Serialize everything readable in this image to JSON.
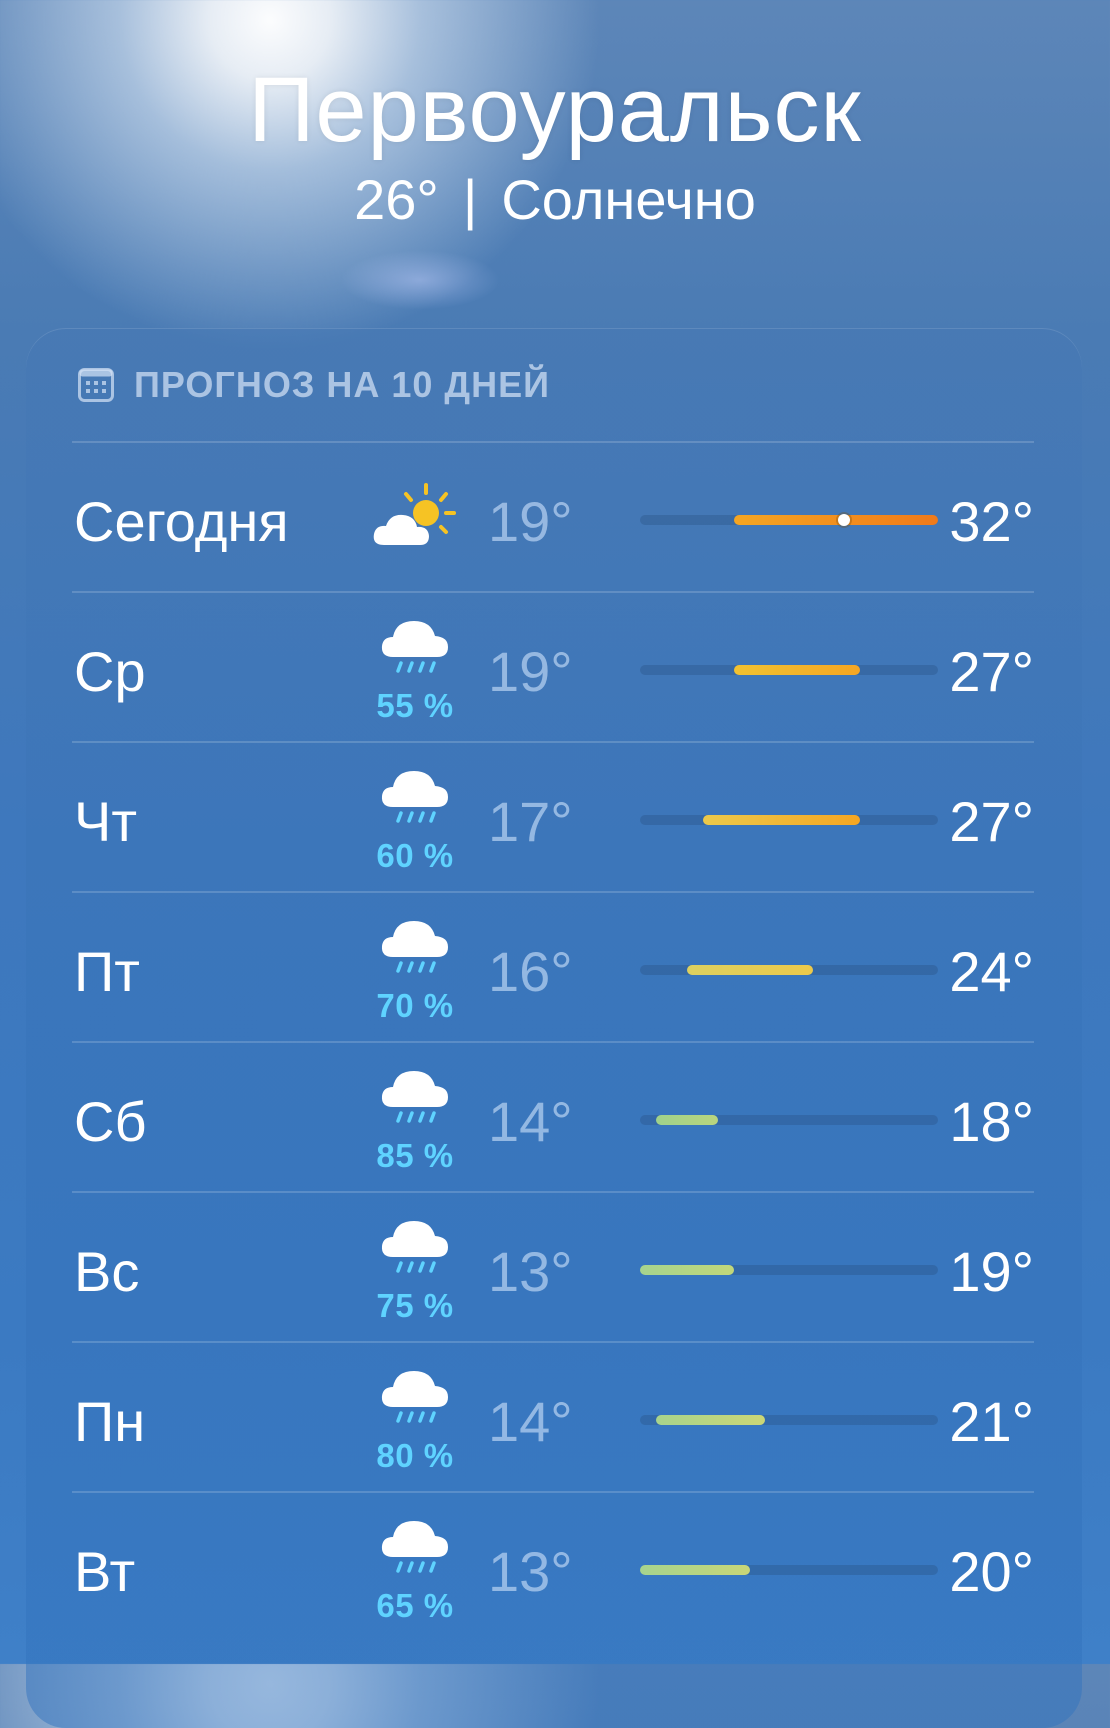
{
  "location": {
    "city": "Первоуральск",
    "current_temp": "26°",
    "separator": "|",
    "condition": "Солнечно"
  },
  "forecast": {
    "title": "ПРОГНОЗ НА 10 ДНЕЙ",
    "header_icon": "calendar-icon",
    "range_min": 13,
    "range_max": 32,
    "current_temp_value": 26,
    "days": [
      {
        "day": "Сегодня",
        "icon": "partly-sunny-icon",
        "precip": "",
        "low": "19°",
        "high": "32°",
        "low_value": 19,
        "high_value": 32,
        "current": true,
        "colors": [
          "#f5a623",
          "#f07a1a"
        ]
      },
      {
        "day": "Ср",
        "icon": "rain-icon",
        "precip": "55 %",
        "low": "19°",
        "high": "27°",
        "low_value": 19,
        "high_value": 27,
        "current": false,
        "colors": [
          "#f1c232",
          "#f5a623"
        ]
      },
      {
        "day": "Чт",
        "icon": "rain-icon",
        "precip": "60 %",
        "low": "17°",
        "high": "27°",
        "low_value": 17,
        "high_value": 27,
        "current": false,
        "colors": [
          "#ecc94b",
          "#f5a623"
        ]
      },
      {
        "day": "Пт",
        "icon": "rain-icon",
        "precip": "70 %",
        "low": "16°",
        "high": "24°",
        "low_value": 16,
        "high_value": 24,
        "current": false,
        "colors": [
          "#dcd060",
          "#ecc94b"
        ]
      },
      {
        "day": "Сб",
        "icon": "rain-icon",
        "precip": "85 %",
        "low": "14°",
        "high": "18°",
        "low_value": 14,
        "high_value": 18,
        "current": false,
        "colors": [
          "#9fd28b",
          "#b9d47e"
        ]
      },
      {
        "day": "Вс",
        "icon": "rain-icon",
        "precip": "75 %",
        "low": "13°",
        "high": "19°",
        "low_value": 13,
        "high_value": 19,
        "current": false,
        "colors": [
          "#a6d48e",
          "#c2d77a"
        ]
      },
      {
        "day": "Пн",
        "icon": "rain-icon",
        "precip": "80 %",
        "low": "14°",
        "high": "21°",
        "low_value": 14,
        "high_value": 21,
        "current": false,
        "colors": [
          "#a8d48c",
          "#cbd676"
        ]
      },
      {
        "day": "Вт",
        "icon": "rain-icon",
        "precip": "65 %",
        "low": "13°",
        "high": "20°",
        "low_value": 13,
        "high_value": 20,
        "current": false,
        "colors": [
          "#a6d48e",
          "#c8d678"
        ]
      }
    ]
  }
}
